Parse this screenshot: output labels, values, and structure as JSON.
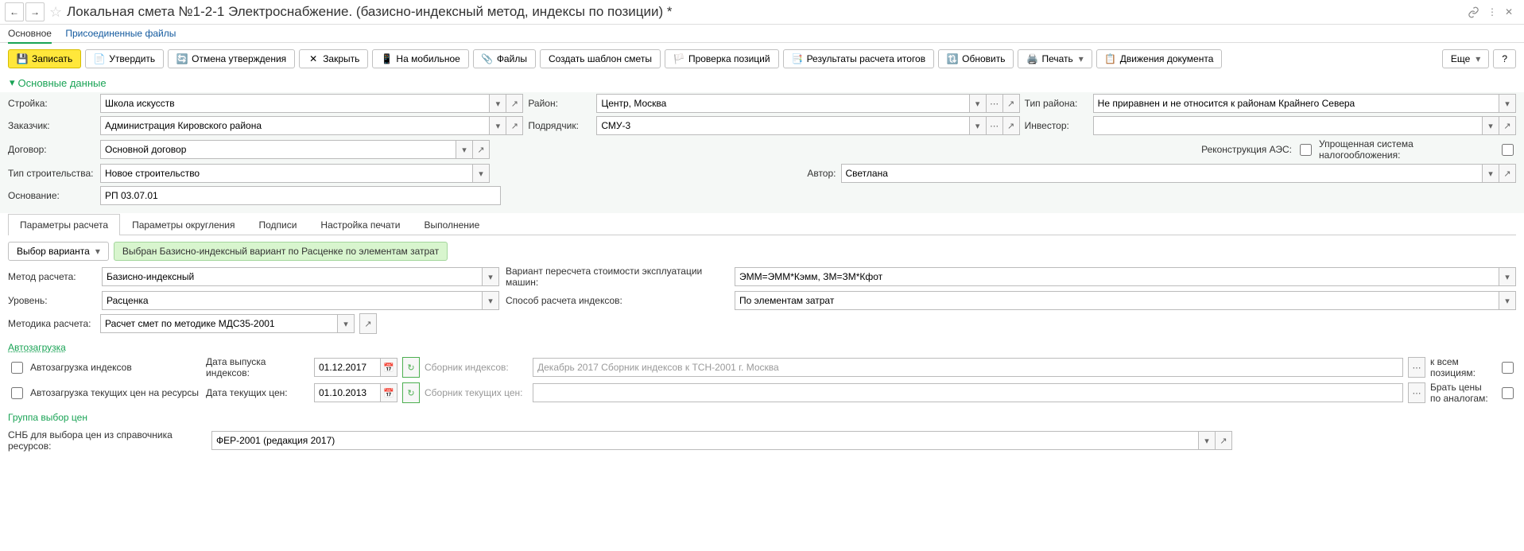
{
  "title": "Локальная смета №1-2-1 Электроснабжение. (базисно-индексный метод, индексы по позиции) *",
  "subnav": {
    "main": "Основное",
    "files": "Присоединенные файлы"
  },
  "toolbar": {
    "save": "Записать",
    "approve": "Утвердить",
    "deny": "Отмена утверждения",
    "close": "Закрыть",
    "mobile": "На мобильное",
    "files": "Файлы",
    "template": "Создать шаблон сметы",
    "check": "Проверка позиций",
    "results": "Результаты расчета итогов",
    "refresh": "Обновить",
    "print": "Печать",
    "moves": "Движения документа",
    "more": "Еще",
    "help": "?"
  },
  "section": "Основные данные",
  "form": {
    "stroika_l": "Стройка:",
    "stroika_v": "Школа искусств",
    "rayon_l": "Район:",
    "rayon_v": "Центр, Москва",
    "tipr_l": "Тип района:",
    "tipr_v": "Не приравнен и не относится к районам Крайнего Севера",
    "zak_l": "Заказчик:",
    "zak_v": "Администрация Кировского района",
    "podr_l": "Подрядчик:",
    "podr_v": "СМУ-3",
    "inv_l": "Инвестор:",
    "inv_v": "",
    "dogovor_l": "Договор:",
    "dogovor_v": "Основной договор",
    "reaes_l": "Реконструкция АЭС:",
    "usn_l": "Упрощенная система налогообложения:",
    "tips_l": "Тип строительства:",
    "tips_v": "Новое строительство",
    "avtor_l": "Автор:",
    "avtor_v": "Светлана",
    "osn_l": "Основание:",
    "osn_v": "РП 03.07.01"
  },
  "tabs": [
    "Параметры расчета",
    "Параметры округления",
    "Подписи",
    "Настройка печати",
    "Выполнение"
  ],
  "calc": {
    "vybor": "Выбор варианта",
    "variant": "Выбран Базисно-индексный вариант по Расценке по элементам затрат",
    "metod_l": "Метод расчета:",
    "metod_v": "Базисно-индексный",
    "varp_l": "Вариант пересчета стоимости эксплуатации машин:",
    "varp_v": "ЭММ=ЭММ*Кэмм, ЗМ=ЗМ*Кфот",
    "uroven_l": "Уровень:",
    "uroven_v": "Расценка",
    "sposob_l": "Способ расчета индексов:",
    "sposob_v": "По элементам затрат",
    "metodika_l": "Методика расчета:",
    "metodika_v": "Расчет смет по методике МДС35-2001"
  },
  "auto": {
    "title": "Автозагрузка",
    "idx": "Автозагрузка индексов",
    "didx_l": "Дата выпуска индексов:",
    "didx_v": "01.12.2017",
    "sbidx_l": "Сборник индексов:",
    "sbidx_v": "Декабрь 2017 Сборник индексов к ТСН-2001 г. Москва",
    "kvsem": "к всем позициям:",
    "tek": "Автозагрузка текущих цен на ресурсы",
    "dtek_l": "Дата текущих цен:",
    "dtek_v": "01.10.2013",
    "sbtek_l": "Сборник текущих цен:",
    "sbtek_v": "",
    "brat": "Брать цены по аналогам:"
  },
  "grp": {
    "title": "Группа выбор цен",
    "snb_l": "СНБ для выбора цен из справочника ресурсов:",
    "snb_v": "ФЕР-2001 (редакция 2017)"
  }
}
